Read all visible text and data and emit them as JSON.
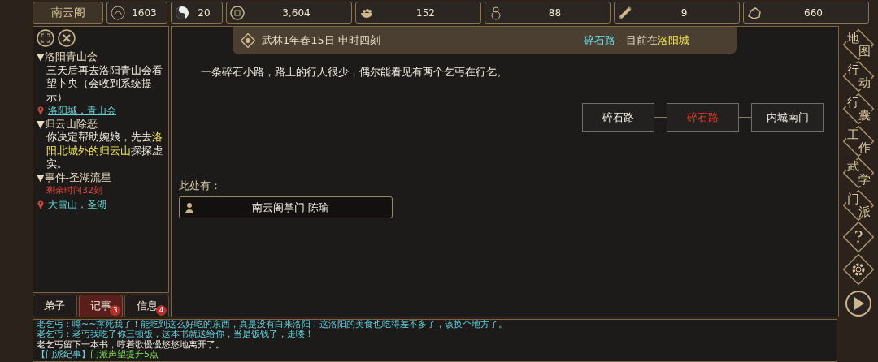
{
  "top_bar": {
    "name": "南云阁",
    "stats": [
      "1603",
      "20",
      "3,604",
      "152",
      "88",
      "9",
      "660"
    ]
  },
  "quests": [
    {
      "title": "▼洛阳青山会",
      "desc": [
        {
          "text": "三天后再去洛阳青山会看望卜央（会收到系统提示）",
          "kind": "normal"
        }
      ],
      "location": "洛阳城，青山会"
    },
    {
      "title": "▼归云山除恶",
      "desc": [
        {
          "text": "你决定帮助婉娘，先去",
          "kind": "normal"
        },
        {
          "text": "洛阳北城外的归云山",
          "kind": "highlight"
        },
        {
          "text": "探探虚实。",
          "kind": "normal"
        }
      ]
    },
    {
      "title": "▼事件-圣湖流星",
      "timer": "剩余时间32刻",
      "location": "大雪山，圣湖"
    }
  ],
  "tabs": [
    {
      "label": "弟子",
      "selected": false
    },
    {
      "label": "记事",
      "selected": true,
      "badge": "3"
    },
    {
      "label": "信息",
      "selected": false,
      "badge": "4"
    }
  ],
  "header": {
    "date": "武林1年春15日 申时四刻",
    "place": "碎石路",
    "separator": " - 目前在",
    "city": "洛阳城"
  },
  "description": "一条碎石小路，路上的行人很少，偶尔能看见有两个乞丐在行乞。",
  "map_nodes": [
    {
      "label": "碎石路",
      "current": false
    },
    {
      "label": "碎石路",
      "current": true
    },
    {
      "label": "内城南门",
      "current": false
    }
  ],
  "here_label": "此处有：",
  "npcs": [
    "南云阁掌门 陈瑜"
  ],
  "side_menu": [
    {
      "kind": "text",
      "label": "地图"
    },
    {
      "kind": "text",
      "label": "行动"
    },
    {
      "kind": "text",
      "label": "行囊"
    },
    {
      "kind": "text",
      "label": "工作"
    },
    {
      "kind": "text",
      "label": "武学"
    },
    {
      "kind": "text",
      "label": "门派"
    },
    {
      "kind": "help",
      "label": "?"
    },
    {
      "kind": "settings"
    },
    {
      "kind": "play"
    }
  ],
  "log": [
    [
      {
        "text": "老乞丐：嗝~~撑死我了！能吃到这么好吃的东西，真是没有白来洛阳！这洛阳的美食也吃得差不多了，该换个地方了。",
        "kind": "speech"
      }
    ],
    [
      {
        "text": "老乞丐：老丐我吃了你三顿饭，这本书就送给你，当是饭钱了，走喽！",
        "kind": "speech"
      }
    ],
    [
      {
        "text": "老乞丐留下一本书，哼着歌慢慢悠悠地离开了。",
        "kind": "narration"
      }
    ],
    [
      {
        "text": "【门派纪事】",
        "kind": "speech"
      },
      {
        "text": "门派声望提升5点",
        "kind": "event"
      }
    ]
  ]
}
